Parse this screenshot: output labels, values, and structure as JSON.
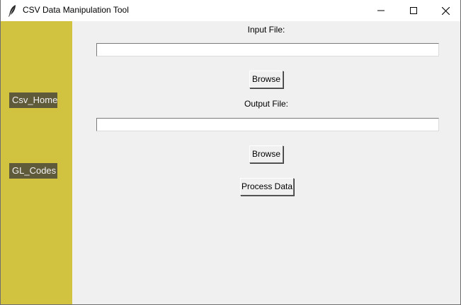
{
  "window": {
    "title": "CSV Data Manipulation Tool",
    "app_icon": "feather-icon",
    "controls": {
      "minimize_icon": "minimize-icon",
      "maximize_icon": "maximize-icon",
      "close_icon": "close-icon"
    }
  },
  "sidebar": {
    "background": "#d1c33f",
    "items": [
      {
        "label": "Csv_Home"
      },
      {
        "label": "GL_Codes"
      }
    ]
  },
  "main": {
    "input_file": {
      "label": "Input File:",
      "value": "",
      "browse_label": "Browse"
    },
    "output_file": {
      "label": "Output File:",
      "value": "",
      "browse_label": "Browse"
    },
    "process_label": "Process Data"
  }
}
